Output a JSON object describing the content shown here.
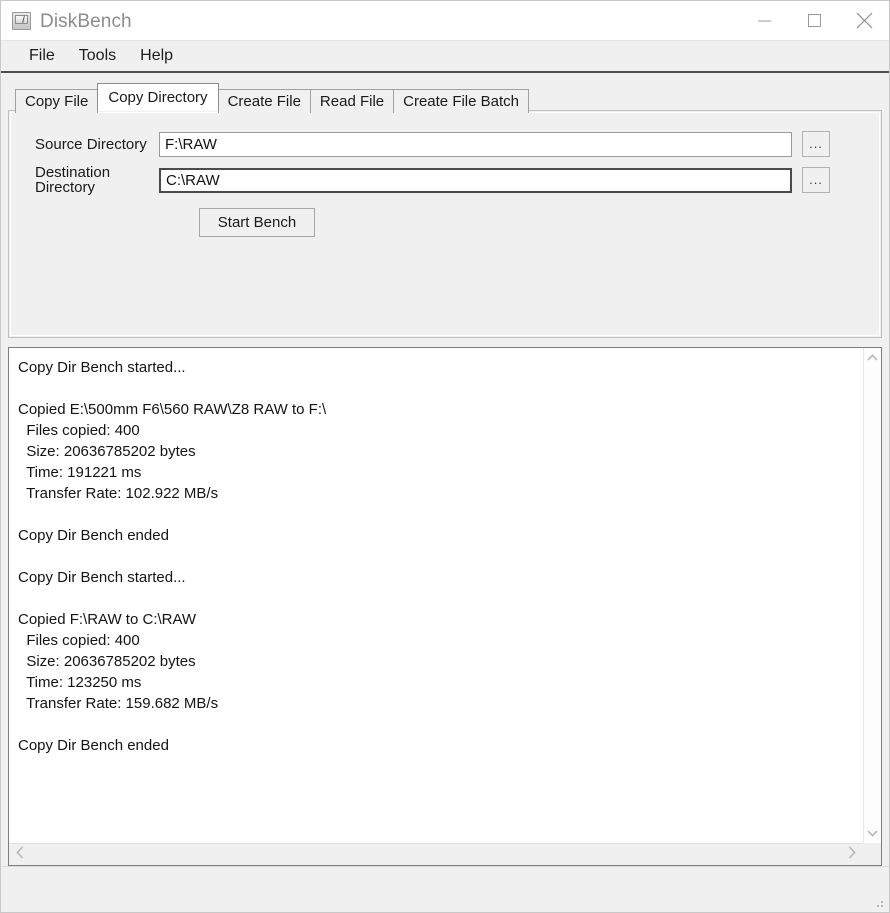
{
  "window": {
    "title": "DiskBench",
    "icon": "disk-monitor-icon",
    "controls": {
      "minimize": "minimize-icon",
      "maximize": "maximize-icon",
      "close": "close-icon"
    }
  },
  "menubar": {
    "items": [
      {
        "label": "File"
      },
      {
        "label": "Tools"
      },
      {
        "label": "Help"
      }
    ]
  },
  "tabs": [
    {
      "label": "Copy File",
      "active": false
    },
    {
      "label": "Copy Directory",
      "active": true
    },
    {
      "label": "Create File",
      "active": false
    },
    {
      "label": "Read File",
      "active": false
    },
    {
      "label": "Create File Batch",
      "active": false
    }
  ],
  "form": {
    "source": {
      "label": "Source Directory",
      "value": "F:\\RAW",
      "placeholder": "",
      "browse_label": "..."
    },
    "destination": {
      "label": "Destination Directory",
      "value": "C:\\RAW",
      "placeholder": "",
      "browse_label": "..."
    },
    "start_button": "Start Bench"
  },
  "log": {
    "text": "Copy Dir Bench started...\n\nCopied E:\\500mm F6\\560 RAW\\Z8 RAW to F:\\\n  Files copied: 400\n  Size: 20636785202 bytes\n  Time: 191221 ms\n  Transfer Rate: 102.922 MB/s\n\nCopy Dir Bench ended\n\nCopy Dir Bench started...\n\nCopied F:\\RAW to C:\\RAW\n  Files copied: 400\n  Size: 20636785202 bytes\n  Time: 123250 ms\n  Transfer Rate: 159.682 MB/s\n\nCopy Dir Bench ended",
    "entries": [
      {
        "header": "Copy Dir Bench started...",
        "copied": "Copied E:\\500mm F6\\560 RAW\\Z8 RAW to F:\\",
        "files_copied": "Files copied: 400",
        "size": "Size: 20636785202 bytes",
        "time": "Time: 191221 ms",
        "transfer_rate": "Transfer Rate: 102.922 MB/s",
        "footer": "Copy Dir Bench ended"
      },
      {
        "header": "Copy Dir Bench started...",
        "copied": "Copied F:\\RAW to C:\\RAW",
        "files_copied": "Files copied: 400",
        "size": "Size: 20636785202 bytes",
        "time": "Time: 123250 ms",
        "transfer_rate": "Transfer Rate: 159.682 MB/s",
        "footer": "Copy Dir Bench ended"
      }
    ],
    "scroll": {
      "up_arrow": "chevron-up-icon",
      "down_arrow": "chevron-down-icon",
      "left_arrow": "chevron-left-icon",
      "right_arrow": "chevron-right-icon"
    }
  },
  "statusbar": {
    "text": ""
  },
  "colors": {
    "window_bg": "#f0f0f0",
    "titlebar_bg": "#ffffff",
    "title_text": "#8d8d8d",
    "field_bg": "#ffffff",
    "focus_border": "#4b4b4b",
    "text": "#141414",
    "menu_underline": "#4e4e4e"
  }
}
